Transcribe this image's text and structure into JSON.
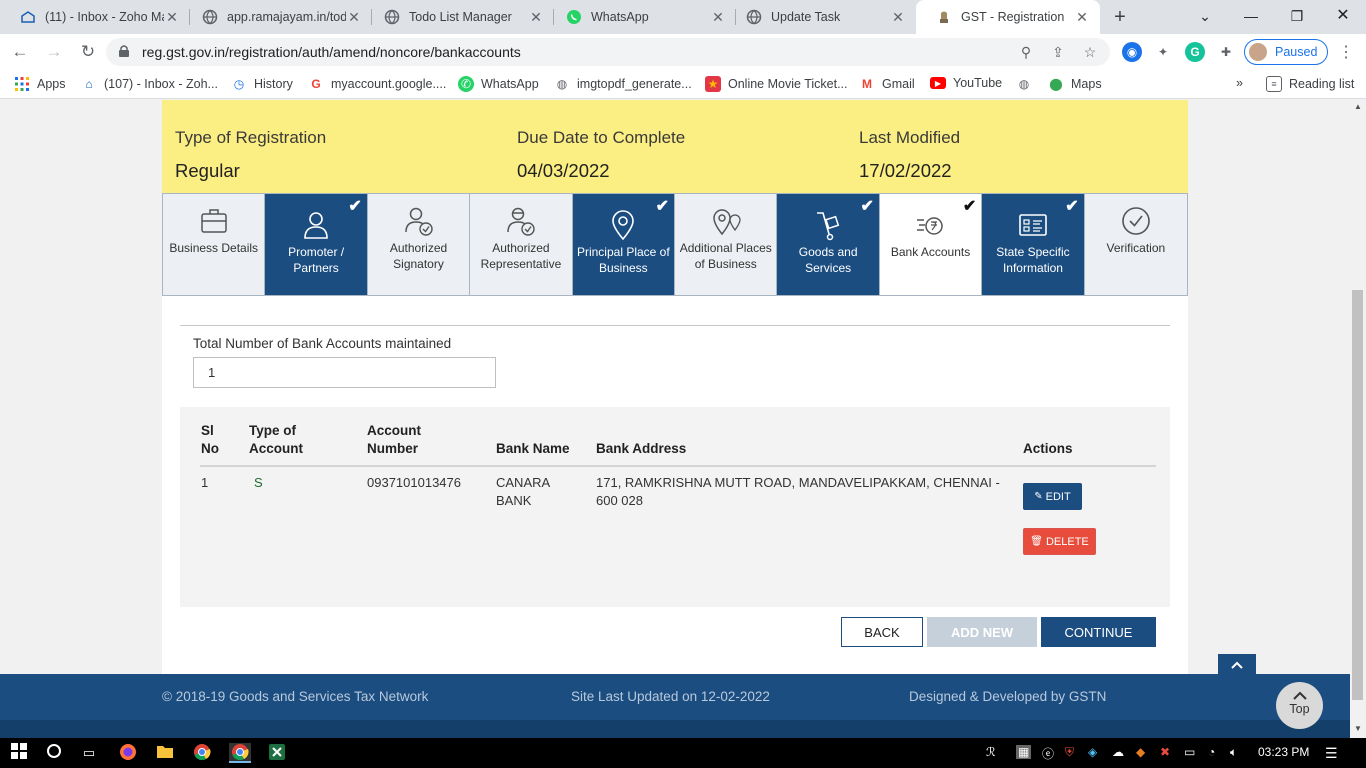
{
  "browser": {
    "tabs": [
      {
        "title": "(11) - Inbox - Zoho Ma",
        "icon": "mail-icon"
      },
      {
        "title": "app.ramajayam.in/tod",
        "icon": "globe-icon"
      },
      {
        "title": "Todo List Manager",
        "icon": "globe-icon"
      },
      {
        "title": "WhatsApp",
        "icon": "whatsapp-icon"
      },
      {
        "title": "Update Task",
        "icon": "globe-icon"
      },
      {
        "title": "GST - Registration",
        "icon": "emblem-icon"
      }
    ],
    "url": "reg.gst.gov.in/registration/auth/amend/noncore/bankaccounts",
    "profile_status": "Paused",
    "bookmarks": [
      {
        "label": "Apps"
      },
      {
        "label": "(107) - Inbox - Zoh..."
      },
      {
        "label": "History"
      },
      {
        "label": "myaccount.google...."
      },
      {
        "label": "WhatsApp"
      },
      {
        "label": "imgtopdf_generate..."
      },
      {
        "label": "Online Movie Ticket..."
      },
      {
        "label": "Gmail"
      },
      {
        "label": "YouTube"
      },
      {
        "label": ""
      },
      {
        "label": "Maps"
      }
    ],
    "reading_list": "Reading list",
    "more_bookmarks": "»"
  },
  "summary": {
    "type_label": "Type of Registration",
    "type_value": "Regular",
    "due_label": "Due Date to Complete",
    "due_value": "04/03/2022",
    "modified_label": "Last Modified",
    "modified_value": "17/02/2022"
  },
  "steps": [
    {
      "label": "Business Details",
      "state": "todo"
    },
    {
      "label": "Promoter / Partners",
      "state": "done"
    },
    {
      "label": "Authorized Signatory",
      "state": "todo"
    },
    {
      "label": "Authorized Representative",
      "state": "todo"
    },
    {
      "label": "Principal Place of Business",
      "state": "done"
    },
    {
      "label": "Additional Places of Business",
      "state": "todo"
    },
    {
      "label": "Goods and Services",
      "state": "done"
    },
    {
      "label": "Bank Accounts",
      "state": "current"
    },
    {
      "label": "State Specific Information",
      "state": "done"
    },
    {
      "label": "Verification",
      "state": "todo"
    }
  ],
  "form": {
    "count_label": "Total Number of Bank Accounts maintained",
    "count_value": "1"
  },
  "table": {
    "headers": {
      "sl": "Sl No",
      "type": "Type of Account",
      "account": "Account Number",
      "bank": "Bank Name",
      "address": "Bank Address",
      "actions": "Actions"
    },
    "rows": [
      {
        "sl": "1",
        "type": "S",
        "account": "0937101013476",
        "bank": "CANARA BANK",
        "address": "171, RAMKRISHNA MUTT ROAD, MANDAVELIPAKKAM, CHENNAI - 600 028",
        "edit": "EDIT",
        "delete": "DELETE"
      }
    ]
  },
  "buttons": {
    "back": "BACK",
    "add_new": "ADD NEW",
    "continue": "CONTINUE"
  },
  "footer": {
    "copyright": "© 2018-19 Goods and Services Tax Network",
    "updated": "Site Last Updated on 12-02-2022",
    "developer": "Designed & Developed by GSTN",
    "top": "Top"
  },
  "taskbar": {
    "time": "03:23 PM"
  },
  "colors": {
    "gst_blue": "#1b4d81",
    "summary_yellow": "#fbee82",
    "delete_red": "#e74c3c",
    "disabled_button": "#c5d0da"
  }
}
